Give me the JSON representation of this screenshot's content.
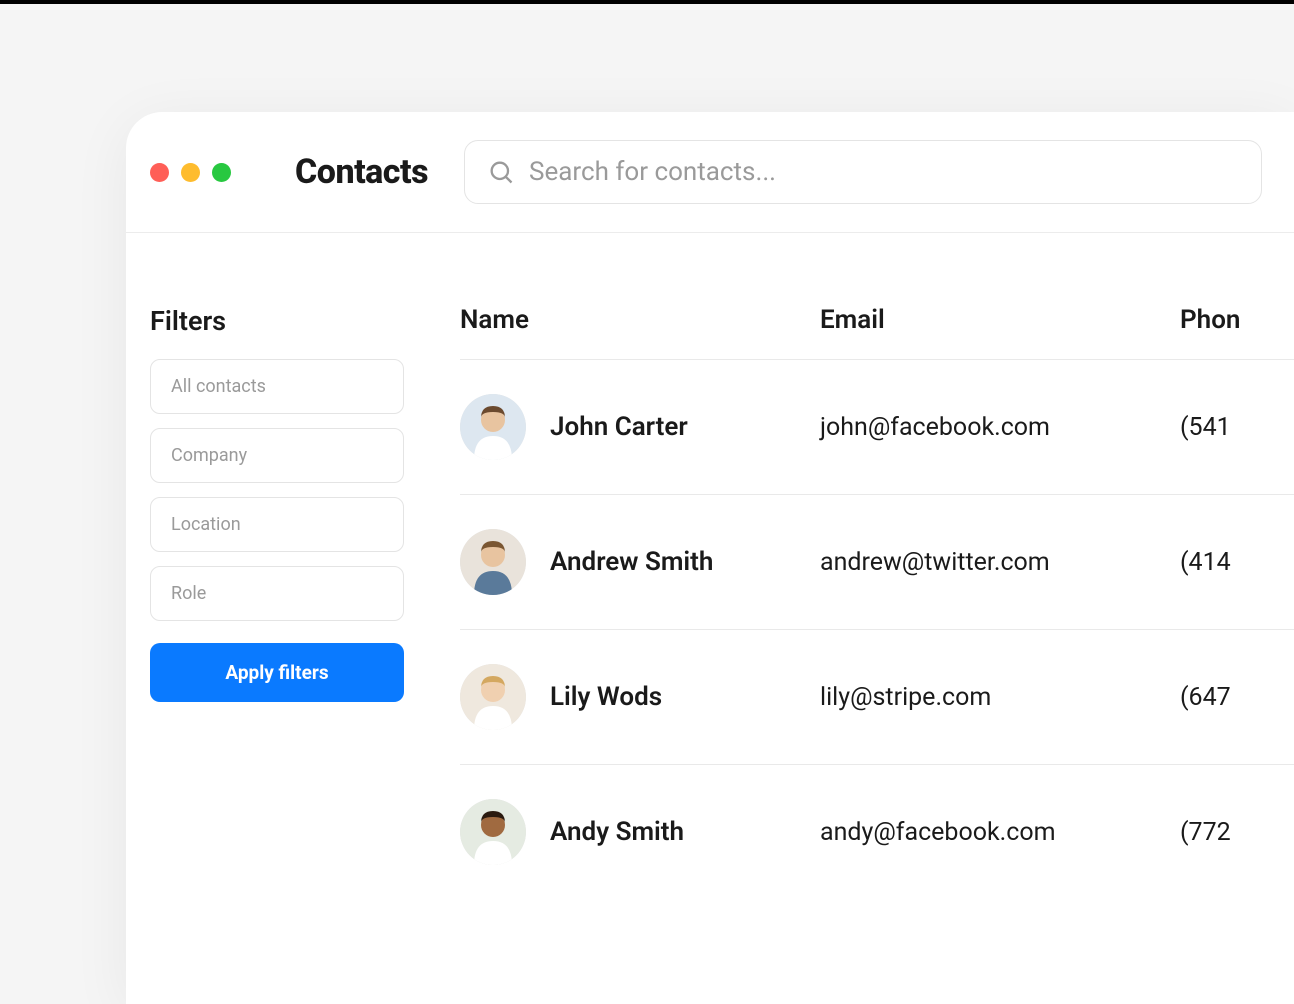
{
  "header": {
    "title": "Contacts",
    "search_placeholder": "Search for contacts..."
  },
  "filters": {
    "title": "Filters",
    "fields": [
      {
        "placeholder": "All contacts"
      },
      {
        "placeholder": "Company"
      },
      {
        "placeholder": "Location"
      },
      {
        "placeholder": "Role"
      }
    ],
    "apply_label": "Apply filters"
  },
  "columns": {
    "name": "Name",
    "email": "Email",
    "phone": "Phon"
  },
  "contacts": [
    {
      "name": "John Carter",
      "email": "john@facebook.com",
      "phone": "(541",
      "avatar_bg": "#dde7f0",
      "avatar_skin": "#e8c4a0",
      "avatar_hair": "#6b4a2f",
      "avatar_shirt": "#ffffff"
    },
    {
      "name": "Andrew Smith",
      "email": "andrew@twitter.com",
      "phone": "(414",
      "avatar_bg": "#e9e3db",
      "avatar_skin": "#e8c4a0",
      "avatar_hair": "#7a5632",
      "avatar_shirt": "#5a7a9a"
    },
    {
      "name": "Lily Wods",
      "email": "lily@stripe.com",
      "phone": "(647",
      "avatar_bg": "#efe8de",
      "avatar_skin": "#f0d0b0",
      "avatar_hair": "#d4a860",
      "avatar_shirt": "#ffffff"
    },
    {
      "name": "Andy Smith",
      "email": "andy@facebook.com",
      "phone": "(772",
      "avatar_bg": "#e5ebe2",
      "avatar_skin": "#a06a40",
      "avatar_hair": "#2a1a0f",
      "avatar_shirt": "#ffffff"
    }
  ]
}
